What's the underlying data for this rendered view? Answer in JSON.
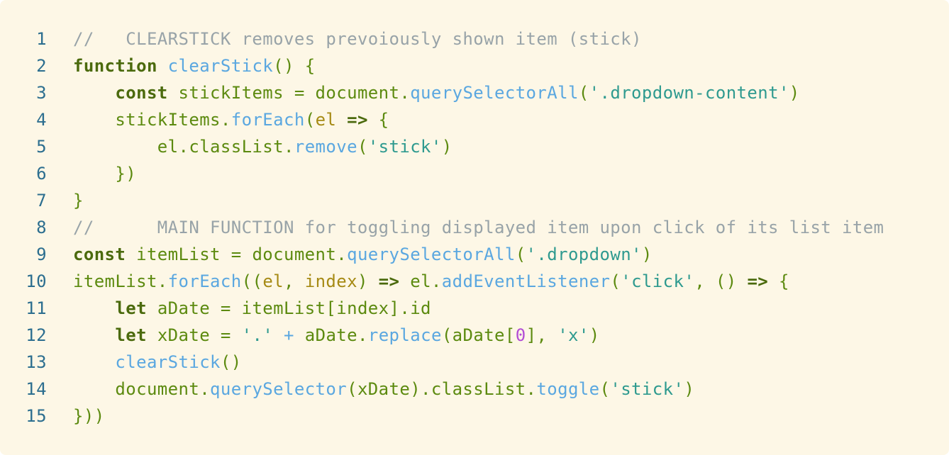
{
  "lines": [
    {
      "num": "1",
      "tokens": [
        {
          "t": "//   CLEARSTICK removes prevoiously shown item (stick)",
          "c": "cm"
        }
      ]
    },
    {
      "num": "2",
      "tokens": [
        {
          "t": "function",
          "c": "kw"
        },
        {
          "t": " ",
          "c": "pl"
        },
        {
          "t": "clearStick",
          "c": "fn"
        },
        {
          "t": "() {",
          "c": "pl"
        }
      ]
    },
    {
      "num": "3",
      "tokens": [
        {
          "t": "    ",
          "c": "pl"
        },
        {
          "t": "const",
          "c": "kw"
        },
        {
          "t": " stickItems = document.",
          "c": "pl"
        },
        {
          "t": "querySelectorAll",
          "c": "fn"
        },
        {
          "t": "(",
          "c": "pl"
        },
        {
          "t": "'.dropdown-content'",
          "c": "str"
        },
        {
          "t": ")",
          "c": "pl"
        }
      ]
    },
    {
      "num": "4",
      "tokens": [
        {
          "t": "    stickItems.",
          "c": "pl"
        },
        {
          "t": "forEach",
          "c": "fn"
        },
        {
          "t": "(",
          "c": "pl"
        },
        {
          "t": "el",
          "c": "param"
        },
        {
          "t": " ",
          "c": "pl"
        },
        {
          "t": "=>",
          "c": "kw"
        },
        {
          "t": " {",
          "c": "pl"
        }
      ]
    },
    {
      "num": "5",
      "tokens": [
        {
          "t": "        el.classList.",
          "c": "pl"
        },
        {
          "t": "remove",
          "c": "fn"
        },
        {
          "t": "(",
          "c": "pl"
        },
        {
          "t": "'stick'",
          "c": "str"
        },
        {
          "t": ")",
          "c": "pl"
        }
      ]
    },
    {
      "num": "6",
      "tokens": [
        {
          "t": "    })",
          "c": "pl"
        }
      ]
    },
    {
      "num": "7",
      "tokens": [
        {
          "t": "}",
          "c": "pl"
        }
      ]
    },
    {
      "num": "8",
      "tokens": [
        {
          "t": "//      MAIN FUNCTION for toggling displayed item upon click of its list item",
          "c": "cm"
        }
      ]
    },
    {
      "num": "9",
      "tokens": [
        {
          "t": "const",
          "c": "kw"
        },
        {
          "t": " itemList = document.",
          "c": "pl"
        },
        {
          "t": "querySelectorAll",
          "c": "fn"
        },
        {
          "t": "(",
          "c": "pl"
        },
        {
          "t": "'.dropdown'",
          "c": "str"
        },
        {
          "t": ")",
          "c": "pl"
        }
      ]
    },
    {
      "num": "10",
      "tokens": [
        {
          "t": "itemList.",
          "c": "pl"
        },
        {
          "t": "forEach",
          "c": "fn"
        },
        {
          "t": "((",
          "c": "pl"
        },
        {
          "t": "el",
          "c": "param"
        },
        {
          "t": ", ",
          "c": "pl"
        },
        {
          "t": "index",
          "c": "param"
        },
        {
          "t": ") ",
          "c": "pl"
        },
        {
          "t": "=>",
          "c": "kw"
        },
        {
          "t": " el.",
          "c": "pl"
        },
        {
          "t": "addEventListener",
          "c": "fn"
        },
        {
          "t": "(",
          "c": "pl"
        },
        {
          "t": "'click'",
          "c": "str"
        },
        {
          "t": ", () ",
          "c": "pl"
        },
        {
          "t": "=>",
          "c": "kw"
        },
        {
          "t": " {",
          "c": "pl"
        }
      ]
    },
    {
      "num": "11",
      "tokens": [
        {
          "t": "    ",
          "c": "pl"
        },
        {
          "t": "let",
          "c": "kw"
        },
        {
          "t": " aDate = itemList[index].id",
          "c": "pl"
        }
      ]
    },
    {
      "num": "12",
      "tokens": [
        {
          "t": "    ",
          "c": "pl"
        },
        {
          "t": "let",
          "c": "kw"
        },
        {
          "t": " xDate = ",
          "c": "pl"
        },
        {
          "t": "'.'",
          "c": "str"
        },
        {
          "t": " ",
          "c": "pl"
        },
        {
          "t": "+",
          "c": "fn"
        },
        {
          "t": " aDate.",
          "c": "pl"
        },
        {
          "t": "replace",
          "c": "fn"
        },
        {
          "t": "(aDate[",
          "c": "pl"
        },
        {
          "t": "0",
          "c": "num"
        },
        {
          "t": "], ",
          "c": "pl"
        },
        {
          "t": "'x'",
          "c": "str"
        },
        {
          "t": ")",
          "c": "pl"
        }
      ]
    },
    {
      "num": "13",
      "tokens": [
        {
          "t": "    ",
          "c": "pl"
        },
        {
          "t": "clearStick",
          "c": "fn"
        },
        {
          "t": "()",
          "c": "pl"
        }
      ]
    },
    {
      "num": "14",
      "tokens": [
        {
          "t": "    document.",
          "c": "pl"
        },
        {
          "t": "querySelector",
          "c": "fn"
        },
        {
          "t": "(xDate).classList.",
          "c": "pl"
        },
        {
          "t": "toggle",
          "c": "fn"
        },
        {
          "t": "(",
          "c": "pl"
        },
        {
          "t": "'stick'",
          "c": "str"
        },
        {
          "t": ")",
          "c": "pl"
        }
      ]
    },
    {
      "num": "15",
      "tokens": [
        {
          "t": "}))",
          "c": "pl"
        }
      ]
    }
  ]
}
